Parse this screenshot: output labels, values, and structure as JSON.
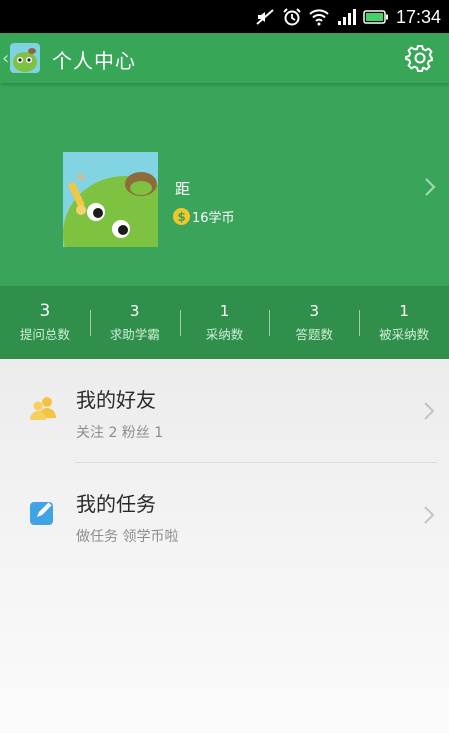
{
  "status_bar": {
    "time": "17:34",
    "icons": [
      "mute-icon",
      "alarm-icon",
      "wifi-icon",
      "signal-icon",
      "battery-icon"
    ]
  },
  "app_bar": {
    "title": "个人中心",
    "back_icon": "back-chevron-icon",
    "settings_icon": "gear-icon"
  },
  "profile": {
    "name": "距",
    "coins_text": "16学币",
    "coin_glyph": "$"
  },
  "stats": [
    {
      "value": "3",
      "label": "提问总数"
    },
    {
      "value": "3",
      "label": "求助学霸"
    },
    {
      "value": "1",
      "label": "采纳数"
    },
    {
      "value": "3",
      "label": "答题数"
    },
    {
      "value": "1",
      "label": "被采纳数"
    }
  ],
  "menu": [
    {
      "title": "我的好友",
      "subtitle": "关注 2  粉丝 1",
      "icon": "friends-icon"
    },
    {
      "title": "我的任务",
      "subtitle": "做任务 领学币啦",
      "icon": "task-edit-icon"
    }
  ],
  "colors": {
    "primary_green": "#37a657",
    "stats_green": "#2f8f4b",
    "friends_icon": "#f5c342",
    "task_icon": "#3fa3e6"
  }
}
